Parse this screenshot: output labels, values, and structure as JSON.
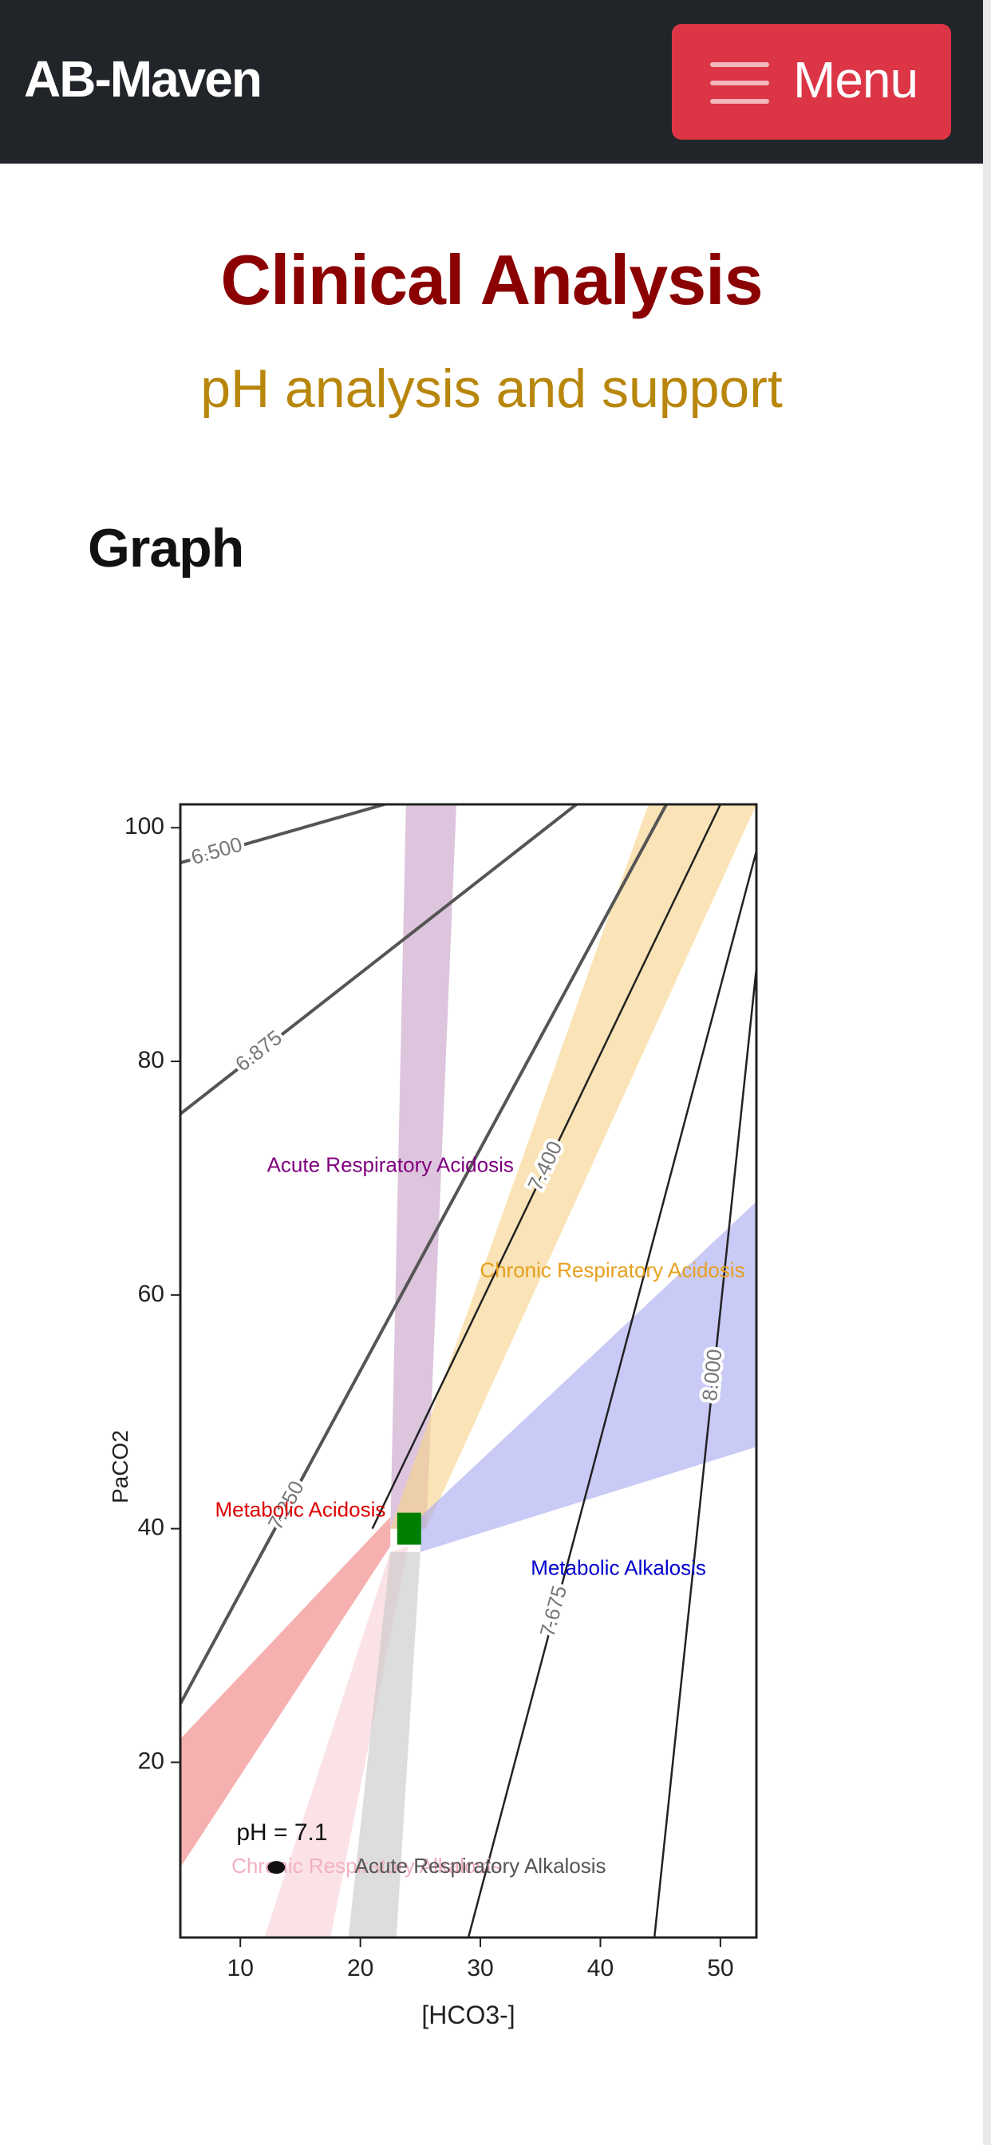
{
  "navbar": {
    "brand": "AB-Maven",
    "menu_label": "Menu",
    "menu_icon": "hamburger-icon",
    "background": "#212529",
    "menu_color": "#dc3545"
  },
  "page": {
    "title": "Clinical Analysis",
    "subtitle": "pH analysis and support",
    "section_heading": "Graph",
    "title_color": "#8b0000",
    "subtitle_color": "#b8860b"
  },
  "chart_data": {
    "type": "line",
    "title": "",
    "xlabel": "[HCO3-]",
    "ylabel": "PaCO2",
    "xlim": [
      5,
      53
    ],
    "ylim": [
      5,
      102
    ],
    "xticks": [
      10,
      20,
      30,
      40,
      50
    ],
    "yticks": [
      20,
      40,
      60,
      80,
      100
    ],
    "grid": false,
    "isopleths": [
      {
        "label": "6.500",
        "points": [
          [
            5,
            97
          ],
          [
            22,
            102
          ]
        ]
      },
      {
        "label": "6.875",
        "points": [
          [
            5,
            75.5
          ],
          [
            38,
            102
          ]
        ]
      },
      {
        "label": "7.250",
        "points": [
          [
            5,
            25
          ],
          [
            45.5,
            102
          ]
        ]
      },
      {
        "label": "7.400",
        "points": [
          [
            21,
            40
          ],
          [
            50,
            102
          ]
        ]
      },
      {
        "label": "7.675",
        "points": [
          [
            29,
            5
          ],
          [
            53,
            98
          ]
        ]
      },
      {
        "label": "8.000",
        "points": [
          [
            44.5,
            5
          ],
          [
            53,
            88
          ]
        ]
      }
    ],
    "regions": [
      {
        "name": "Acute Respiratory Acidosis",
        "color": "#800080",
        "fill": "#c8a2c8",
        "polygon": [
          [
            22.5,
            40
          ],
          [
            25.5,
            40
          ],
          [
            28,
            102
          ],
          [
            23.8,
            102
          ]
        ]
      },
      {
        "name": "Chronic Respiratory Acidosis",
        "color": "#e6a020",
        "fill": "#f7d48a",
        "polygon": [
          [
            22.5,
            40
          ],
          [
            25.5,
            40
          ],
          [
            53,
            102
          ],
          [
            44,
            102
          ]
        ]
      },
      {
        "name": "Metabolic Alkalosis",
        "color": "#0000cc",
        "fill": "#aaaaf0",
        "polygon": [
          [
            25,
            41
          ],
          [
            25,
            38
          ],
          [
            53,
            47
          ],
          [
            53,
            68
          ]
        ]
      },
      {
        "name": "Metabolic Acidosis",
        "color": "#dd0000",
        "fill": "#f08080",
        "polygon": [
          [
            22.5,
            41
          ],
          [
            22.5,
            38.5
          ],
          [
            5,
            11
          ],
          [
            5,
            22
          ]
        ]
      },
      {
        "name": "Chronic Respiratory Alkalosis",
        "color": "#e090a0",
        "fill": "#f8d0d8",
        "polygon": [
          [
            22.5,
            38
          ],
          [
            24,
            38.5
          ],
          [
            17.5,
            5
          ],
          [
            12,
            5
          ]
        ]
      },
      {
        "name": "Acute Respiratory Alkalosis",
        "color": "#808080",
        "fill": "#c8c8c8",
        "polygon": [
          [
            22.5,
            38
          ],
          [
            25,
            38
          ],
          [
            23,
            5
          ],
          [
            19,
            5
          ]
        ]
      }
    ],
    "region_labels": [
      {
        "text": "Acute Respiratory Acidosis",
        "x": 22.5,
        "y": 71,
        "color": "#800080"
      },
      {
        "text": "Chronic Respiratory Acidosis",
        "x": 41,
        "y": 62,
        "color": "#e6a020"
      },
      {
        "text": "Metabolic Acidosis",
        "x": 15,
        "y": 41.5,
        "color": "#dd0000"
      },
      {
        "text": "Metabolic Alkalosis",
        "x": 41.5,
        "y": 36.5,
        "color": "#0000cc"
      },
      {
        "text": "Chronic Respiratory Alkalosis",
        "x": 20.5,
        "y": 11,
        "color": "#f0b0c0"
      },
      {
        "text": "Acute Respiratory Alkalosis",
        "x": 30,
        "y": 11,
        "color": "#555555"
      }
    ],
    "normal_point": {
      "x": 24,
      "y": 40,
      "color": "#008000"
    },
    "patient_point": {
      "x": 13,
      "y": 11,
      "label": "pH = 7.1"
    }
  }
}
